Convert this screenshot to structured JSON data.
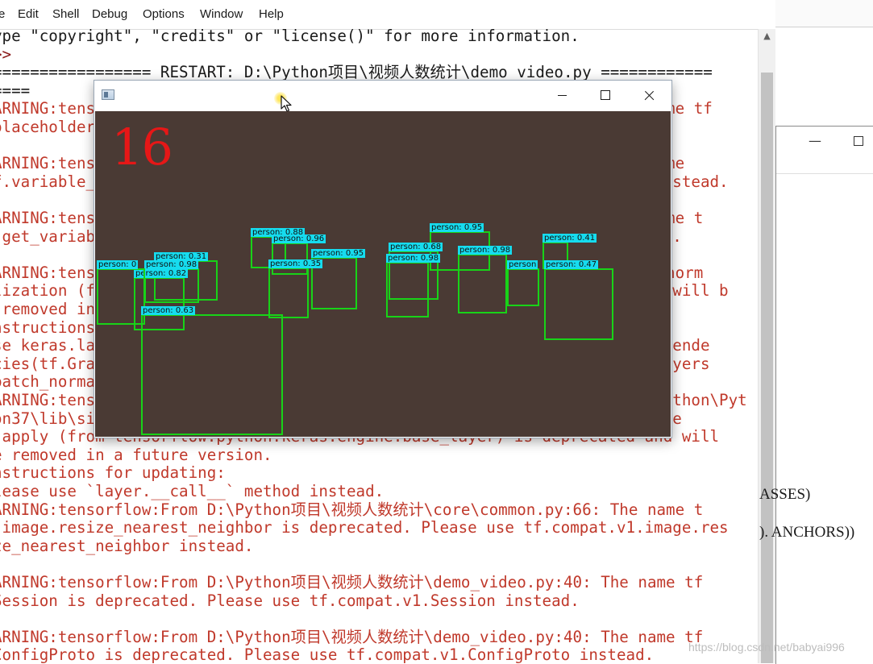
{
  "shell": {
    "menu": [
      "e",
      "Edit",
      "Shell",
      "Debug",
      "Options",
      "Window",
      "Help"
    ],
    "lines": [
      {
        "text": "ype \"copyright\", \"credits\" or \"license()\" for more information.",
        "kind": "info"
      },
      {
        "text": ">>",
        "kind": "prompt"
      },
      {
        "text": "================= RESTART: D:\\Python项目\\视频人数统计\\demo_video.py ============",
        "kind": "info"
      },
      {
        "text": "====",
        "kind": "info"
      },
      {
        "text": "ARNING:tensorflow:From D:\\Python项目\\视频人数统计\\core\\common.py:66: The name tf",
        "kind": "warn"
      },
      {
        "text": "placeholder is deprecated. Please use tf.compat.v1.placeholder instead.",
        "kind": "warn"
      },
      {
        "text": "",
        "kind": "warn"
      },
      {
        "text": "ARNING:tensorflow:From D:\\Python项目\\视频人数统计\\core\\common.py:66: The name",
        "kind": "warn"
      },
      {
        "text": "f.variable_scope is deprecated. Please use tf.compat.v1.variable_scope instead.",
        "kind": "warn"
      },
      {
        "text": "",
        "kind": "warn"
      },
      {
        "text": "ARNING:tensorflow:From D:\\Python项目\\视频人数统计\\core\\common.py:66: The name t",
        "kind": "warn"
      },
      {
        "text": " get_variable is deprecated. Please use tf.compat.v1.get_variable instead.",
        "kind": "warn"
      },
      {
        "text": "",
        "kind": "warn"
      },
      {
        "text": "ARNING:tensorflow:From D:\\Python项目\\视频人数统计\\core\\common.py:66: batch_norm",
        "kind": "warn"
      },
      {
        "text": "lization (from tensorflow.python.layers.normalization) is deprecated and will b",
        "kind": "warn"
      },
      {
        "text": " removed in a future version.",
        "kind": "warn"
      },
      {
        "text": "nstructions for updating:",
        "kind": "warn"
      },
      {
        "text": "se keras.layers.BatchNormalization instead. In particular, tf.control_depende",
        "kind": "warn"
      },
      {
        "text": "cies(tf.GraphKeys.UPDATE_OPS) should not be used (consult the tf.keras.layers",
        "kind": "warn"
      },
      {
        "text": "batch_normalization documentation).",
        "kind": "warn"
      },
      {
        "text": "ARNING:tensorflow:From D:\\Python\\Python37\\lib\\site-packages\\tensorflow\\python\\Pyt",
        "kind": "warn"
      },
      {
        "text": "on37\\lib\\site-packages\\tensorflow\\python\\layers\\normalization.py:327: Laye",
        "kind": "warn"
      },
      {
        "text": " apply (from tensorflow.python.keras.engine.base_layer) is deprecated and will",
        "kind": "warn"
      },
      {
        "text": "e removed in a future version.",
        "kind": "warn"
      },
      {
        "text": "nstructions for updating:",
        "kind": "warn"
      },
      {
        "text": "lease use `layer.__call__` method instead.",
        "kind": "warn"
      },
      {
        "text": "ARNING:tensorflow:From D:\\Python项目\\视频人数统计\\core\\common.py:66: The name t",
        "kind": "warn"
      },
      {
        "text": " image.resize_nearest_neighbor is deprecated. Please use tf.compat.v1.image.res",
        "kind": "warn"
      },
      {
        "text": "ze_nearest_neighbor instead.",
        "kind": "warn"
      },
      {
        "text": "",
        "kind": "warn"
      },
      {
        "text": "ARNING:tensorflow:From D:\\Python项目\\视频人数统计\\demo_video.py:40: The name tf",
        "kind": "warn"
      },
      {
        "text": "Session is deprecated. Please use tf.compat.v1.Session instead.",
        "kind": "warn"
      },
      {
        "text": "",
        "kind": "warn"
      },
      {
        "text": "ARNING:tensorflow:From D:\\Python项目\\视频人数统计\\demo_video.py:40: The name tf",
        "kind": "warn"
      },
      {
        "text": "ConfigProto is deprecated. Please use tf.compat.v1.ConfigProto instead.",
        "kind": "warn"
      }
    ],
    "scroll_up_icon": "chevron-up-icon"
  },
  "right_editor": {
    "code_fragments": [
      "ASSES)",
      "). ANCHORS))"
    ],
    "watermark": "https://blog.csdn.net/babyai996"
  },
  "video_window": {
    "title": "",
    "icon": "app-window-icon",
    "count": "16",
    "detections": [
      {
        "label": "person: 0.88"
      },
      {
        "label": "person: 0.96"
      },
      {
        "label": "person: 0.95"
      },
      {
        "label": "person: 0.35"
      },
      {
        "label": "person: 0.31"
      },
      {
        "label": "person: 0.98"
      },
      {
        "label": "person: 0.82"
      },
      {
        "label": "person: 0"
      },
      {
        "label": "person: 0.63"
      },
      {
        "label": "person: 0.95"
      },
      {
        "label": "person: 0.68"
      },
      {
        "label": "person: 0.98"
      },
      {
        "label": "person: 0.98"
      },
      {
        "label": "person: 0.41"
      },
      {
        "label": "person: 0.47"
      },
      {
        "label": "person"
      }
    ]
  }
}
